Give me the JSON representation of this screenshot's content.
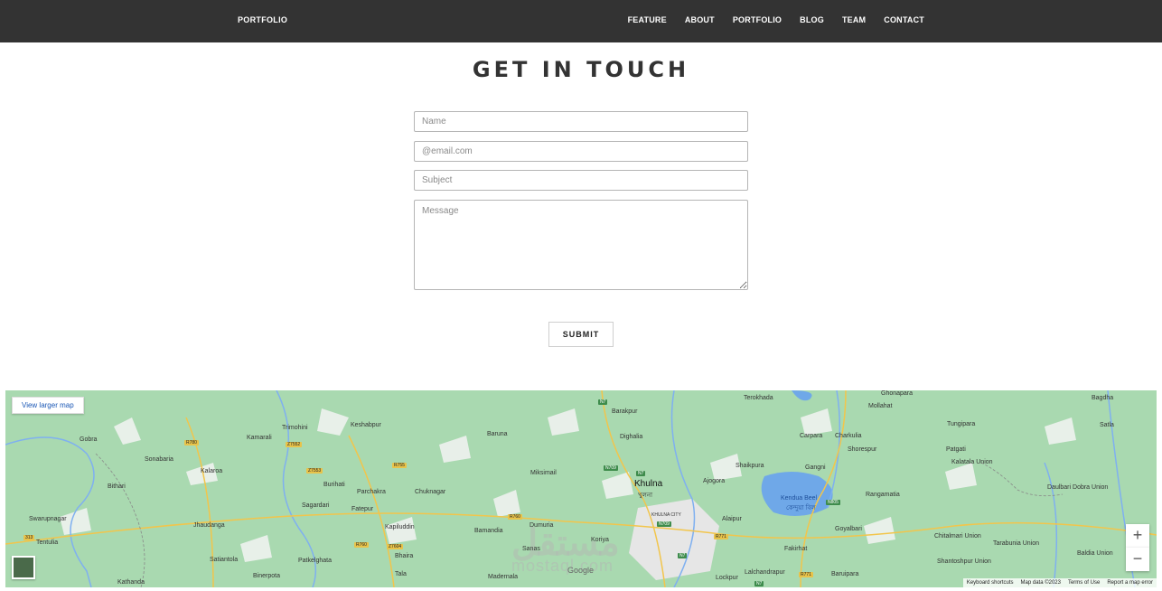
{
  "nav": {
    "brand": "PORTFOLIO",
    "links": [
      "FEATURE",
      "ABOUT",
      "PORTFOLIO",
      "BLOG",
      "TEAM",
      "CONTACT"
    ]
  },
  "contact": {
    "title": "GET IN TOUCH",
    "name_placeholder": "Name",
    "email_placeholder": "@email.com",
    "subject_placeholder": "Subject",
    "message_placeholder": "Message",
    "submit_label": "SUBMIT"
  },
  "map": {
    "view_larger": "View larger map",
    "zoom_in": "+",
    "zoom_out": "−",
    "google": "Google",
    "footer": [
      "Keyboard shortcuts",
      "Map data ©2023",
      "Terms of Use",
      "Report a map error"
    ],
    "watermark_ar": "مستقل",
    "watermark_en": "mostaql.com",
    "labels": {
      "khulna": "Khulna",
      "khulna_bn": "খুলনা",
      "khulna_city": "KHULNA CITY",
      "kendua": "Kendua Beel",
      "kendua_bn": "কেন্দুয়া বিল",
      "gobra": "Gobra",
      "sonabaria": "Sonabaria",
      "bithari": "Bithari",
      "swarupnagar": "Swarupnagar",
      "tentulia": "Tentulia",
      "kathanda": "Kathanda",
      "kamarali": "Kamarali",
      "trimohini": "Trimohini",
      "keshabpur": "Keshabpur",
      "kalaroa": "Kalaroa",
      "jhaudanga": "Jhaudanga",
      "satiantola": "Satiantola",
      "binerpota": "Binerpota",
      "burihati": "Burihati",
      "parchakra": "Parchakra",
      "sagardari": "Sagardari",
      "fatepur": "Fatepur",
      "chuknagar": "Chuknagar",
      "kapiluddin": "Kapiluddin",
      "bhaira": "Bhaira",
      "patkelghata": "Patkelghata",
      "tala": "Tala",
      "baruna": "Baruna",
      "miksimail": "Miksimail",
      "bamandia": "Bamandia",
      "dumuria": "Dumuria",
      "madernala": "Madernala",
      "barakpur": "Barakpur",
      "dighalia": "Dighalia",
      "ajogora": "Ajogora",
      "alaipur": "Alaipur",
      "shaikpura": "Shaikpura",
      "terokhada": "Terokhada",
      "carpara": "Carpara",
      "charkulia": "Charkulia",
      "gangni": "Gangni",
      "mollahat": "Mollahat",
      "ghonapara": "Ghonapara",
      "shorespur": "Shorespur",
      "rangamatia": "Rangamatia",
      "goyalbari": "Goyalbari",
      "fakirhat": "Fakirhat",
      "baruipara": "Baruipara",
      "lalchandrapur": "Lalchandrapur",
      "lockpur": "Lockpur",
      "tungipara": "Tungipara",
      "patgati": "Patgati",
      "kalatala": "Kalatala Union",
      "bagdha": "Bagdha",
      "satla": "Satla",
      "daulbari": "Daulbari Dobra Union",
      "chitalmari": "Chitalmari Union",
      "tarabunia": "Tarabunia Union",
      "santoshpur": "Shantoshpur Union",
      "baldia": "Baldia Union",
      "sanas": "Sanas",
      "koriya": "Koriya"
    },
    "roads": [
      "R780",
      "Z7552",
      "R755",
      "Z7553",
      "R760",
      "R760",
      "Z7604",
      "N7",
      "N709",
      "N7",
      "N709",
      "N805",
      "R771",
      "R771",
      "N7",
      "313",
      "N7"
    ]
  }
}
